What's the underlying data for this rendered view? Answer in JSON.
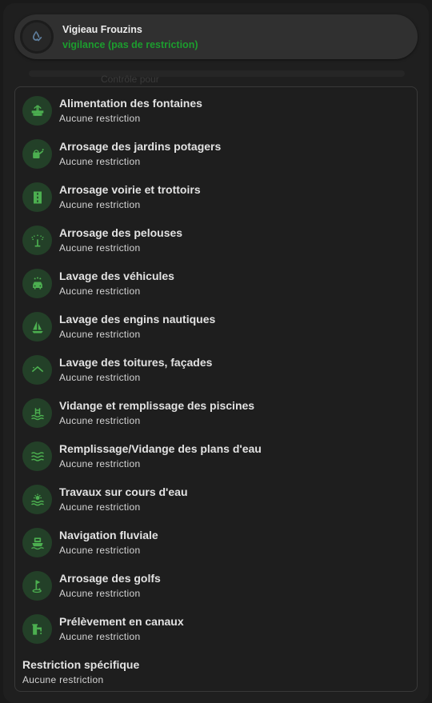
{
  "header": {
    "title": "Vigieau Frouzins",
    "status": "vigilance (pas de restriction)",
    "status_color": "#1c9d2e",
    "icon": "water-check-icon"
  },
  "background_hint": "Contrôle pour",
  "accent_color": "#4caf50",
  "restrictions": [
    {
      "label": "Alimentation des fontaines",
      "status": "Aucune restriction",
      "icon": "fountain-icon"
    },
    {
      "label": "Arrosage des jardins potagers",
      "status": "Aucune restriction",
      "icon": "watering-can-icon"
    },
    {
      "label": "Arrosage voirie et trottoirs",
      "status": "Aucune restriction",
      "icon": "road-icon"
    },
    {
      "label": "Arrosage des pelouses",
      "status": "Aucune restriction",
      "icon": "sprinkler-icon"
    },
    {
      "label": "Lavage des véhicules",
      "status": "Aucune restriction",
      "icon": "car-wash-icon"
    },
    {
      "label": "Lavage des engins nautiques",
      "status": "Aucune restriction",
      "icon": "sailboat-icon"
    },
    {
      "label": "Lavage des toitures, façades",
      "status": "Aucune restriction",
      "icon": "roof-icon"
    },
    {
      "label": "Vidange et remplissage des piscines",
      "status": "Aucune restriction",
      "icon": "pool-icon"
    },
    {
      "label": "Remplissage/Vidange des plans d'eau",
      "status": "Aucune restriction",
      "icon": "waves-icon"
    },
    {
      "label": "Travaux sur cours d'eau",
      "status": "Aucune restriction",
      "icon": "river-work-icon"
    },
    {
      "label": "Navigation fluviale",
      "status": "Aucune restriction",
      "icon": "ferry-icon"
    },
    {
      "label": "Arrosage des golfs",
      "status": "Aucune restriction",
      "icon": "golf-icon"
    },
    {
      "label": "Prélèvement en canaux",
      "status": "Aucune restriction",
      "icon": "water-pump-icon"
    }
  ],
  "specific": {
    "label": "Restriction spécifique",
    "status": "Aucune restriction"
  }
}
